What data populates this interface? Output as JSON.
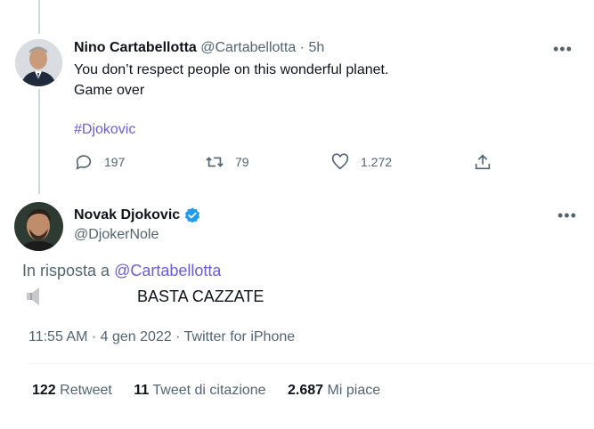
{
  "reply_tweet": {
    "name": "Nino Cartabellotta",
    "handle": "@Cartabellotta",
    "separator": "·",
    "time": "5h",
    "text_line1": "You don’t respect people on this wonderful planet.",
    "text_line2": "Game over",
    "hashtag": "#Djokovic",
    "replies": "197",
    "retweets": "79",
    "likes": "1.272"
  },
  "main_tweet": {
    "name": "Novak Djokovic",
    "handle": "@DjokerNole",
    "in_reply_prefix": "In risposta a",
    "in_reply_handle": "@Cartabellotta",
    "text": "BASTA CAZZATE",
    "meta": "11:55 AM · 4 gen 2022 · Twitter for iPhone",
    "retweet_count": "122",
    "retweet_label": "Retweet",
    "quote_count": "11",
    "quote_label": "Tweet di citazione",
    "like_count": "2.687",
    "like_label": "Mi piace"
  },
  "colors": {
    "verified": "#1d9bf0",
    "link": "#6a5fd6",
    "muted": "#536471"
  }
}
